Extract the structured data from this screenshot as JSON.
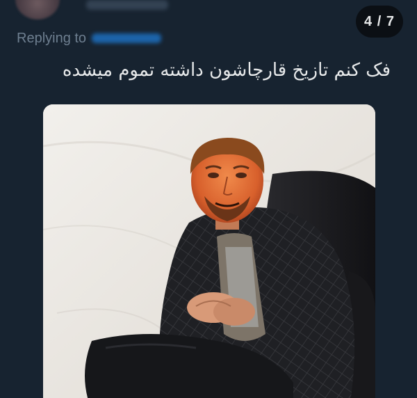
{
  "pager": {
    "counter": "4 / 7"
  },
  "tweet": {
    "replying_to_label": "Replying to",
    "text": "فک کنم تازیخ قارچاشون داشته تموم میشده"
  },
  "media": {
    "kind": "photo"
  },
  "icons": {
    "avatar": "user-avatar"
  }
}
